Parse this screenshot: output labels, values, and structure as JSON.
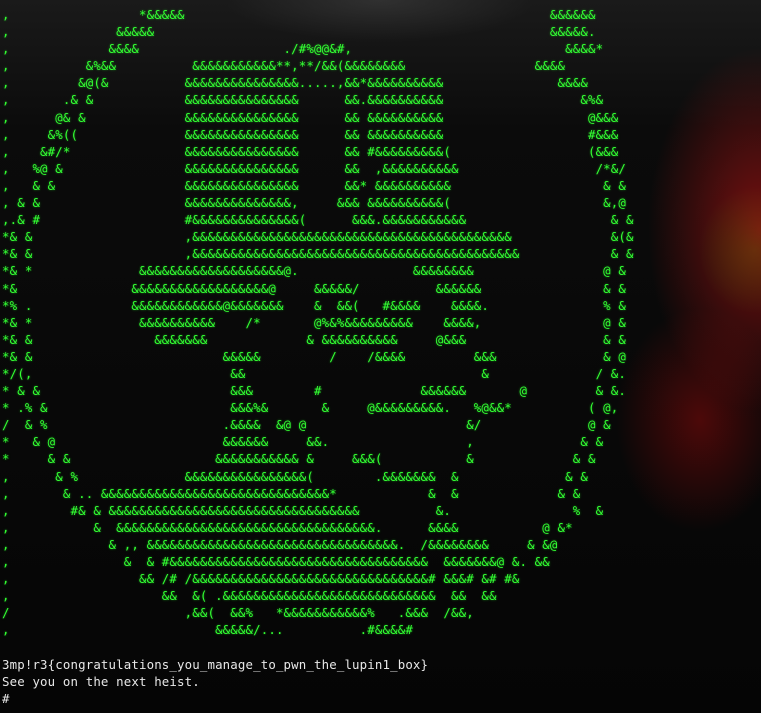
{
  "ascii_art": [
    ",                 *&&&&&                                                &&&&&&",
    ",              &&&&&                                                    &&&&&.",
    ",             &&&&                   ./#%@@&#,                            &&&&*",
    ",          &%&&          &&&&&&&&&&&**,**/&&(&&&&&&&&                 &&&&",
    ",         &@(&          &&&&&&&&&&&&&&&.....,&&*&&&&&&&&&&               &&&&",
    ",       .& &            &&&&&&&&&&&&&&&      &&.&&&&&&&&&&                  &%&",
    ",      @& &             &&&&&&&&&&&&&&&      && &&&&&&&&&&                   @&&&",
    ",     &%((              &&&&&&&&&&&&&&&      && &&&&&&&&&&                   #&&&",
    ",    &#/*               &&&&&&&&&&&&&&&      && #&&&&&&&&&(                  (&&&",
    ",   %@ &                &&&&&&&&&&&&&&&      &&  ,&&&&&&&&&&                  /*&/",
    ",   & &                 &&&&&&&&&&&&&&&      &&* &&&&&&&&&&                    & &",
    ", & &                   &&&&&&&&&&&&&&,     &&& &&&&&&&&&&(                    &,@",
    ",.& #                   #&&&&&&&&&&&&&&(      &&&.&&&&&&&&&&&                   & &",
    "*& &                    ,&&&&&&&&&&&&&&&&&&&&&&&&&&&&&&&&&&&&&&&&&&             &(&",
    "*& &                    ,&&&&&&&&&&&&&&&&&&&&&&&&&&&&&&&&&&&&&&&&&&&            & &",
    "*& *              &&&&&&&&&&&&&&&&&&&@.               &&&&&&&&                 @ &",
    "*&               &&&&&&&&&&&&&&&&&&@     &&&&&/          &&&&&&                & &",
    "*% .             &&&&&&&&&&&&@&&&&&&&    &  &&(   #&&&&    &&&&.               % &",
    "*& *              &&&&&&&&&&    /*       @%&%&&&&&&&&&    &&&&,                @ &",
    "*& &                &&&&&&&             & &&&&&&&&&&     @&&&                  & &",
    "*& &                         &&&&&         /    /&&&&         &&&              & @",
    "*/(,                          &&                               &              / &.",
    "* & &                         &&&        #             &&&&&&       @         & &.",
    "* .% &                        &&&%&       &     @&&&&&&&&&.   %@&&*          ( @,",
    "/  & %                       .&&&&  &@ @                     &/              @ &",
    "*   & @                      &&&&&&     &&.                  ,              & &",
    "*     & &                   &&&&&&&&&&& &     &&&(           &             & &",
    ",      & %              &&&&&&&&&&&&&&&&(        .&&&&&&&  &              & &",
    ",       & .. &&&&&&&&&&&&&&&&&&&&&&&&&&&&&&*            &  &             & &",
    ",        #& & &&&&&&&&&&&&&&&&&&&&&&&&&&&&&&&&&          &.                %  &",
    ",           &  &&&&&&&&&&&&&&&&&&&&&&&&&&&&&&&&&&.      &&&&           @ &*",
    ",             & ,, &&&&&&&&&&&&&&&&&&&&&&&&&&&&&&&&&.  /&&&&&&&&     & &@",
    ",               &  & #&&&&&&&&&&&&&&&&&&&&&&&&&&&&&&&&&&  &&&&&&&@ &. &&",
    ",                 && /# /&&&&&&&&&&&&&&&&&&&&&&&&&&&&&&&# &&&# &# #&",
    ",                    &&  &( .&&&&&&&&&&&&&&&&&&&&&&&&&&&&  &&  &&",
    "/                       ,&&(  &&%   *&&&&&&&&&&&%   .&&&  /&&,",
    ",                           &&&&&/...          .#&&&&#"
  ],
  "flag_line": "3mp!r3{congratulations_you_manage_to_pwn_the_lupin1_box}",
  "message_line": "See you on the next heist.",
  "prompt": "#",
  "colors": {
    "terminal_green": "#33ff33",
    "text_white": "#e8e8e8",
    "background": "#000000"
  }
}
